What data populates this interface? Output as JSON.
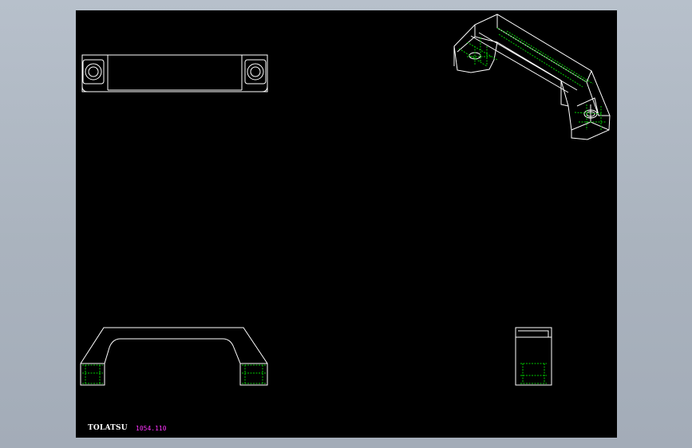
{
  "title_block": {
    "brand": "TOLATSU",
    "part_number": "1054.110"
  },
  "colors": {
    "background_viewport": "#a9b2bd",
    "drawing_area": "#000000",
    "outline": "#ffffff",
    "hidden_line": "#00cc00",
    "part_number_text": "#ff33ff"
  },
  "views": [
    "top-view",
    "isometric-view",
    "front-view",
    "side-view"
  ]
}
